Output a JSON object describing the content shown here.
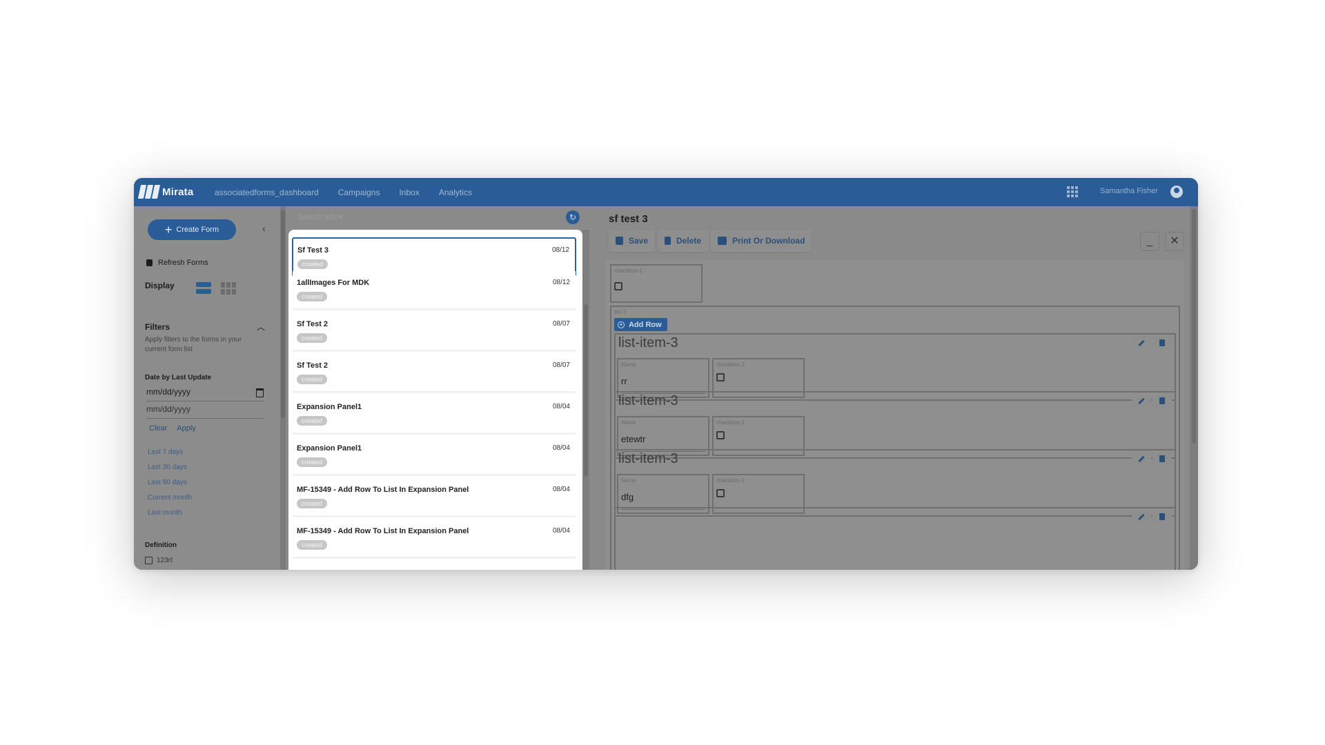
{
  "header": {
    "brand": "Mirata",
    "nav": [
      "associatedforms_dashboard",
      "Campaigns",
      "Inbox",
      "Analytics"
    ],
    "user_name": "Samantha Fisher"
  },
  "sidebar": {
    "create_label": "Create Form",
    "refresh_label": "Refresh Forms",
    "display_label": "Display",
    "filters_title": "Filters",
    "filters_desc": "Apply filters to the forms in your current form list",
    "date_label": "Date by Last Update",
    "date_from": "mm/dd/yyyy",
    "date_to": "mm/dd/yyyy",
    "clear_label": "Clear",
    "apply_label": "Apply",
    "quick_filters": [
      "Last 7 days",
      "Last 30 days",
      "Last 90 days",
      "Current month",
      "Last month"
    ],
    "definition_label": "Definition",
    "definition_items": [
      "123rt"
    ]
  },
  "inbox": {
    "search_placeholder": "Search Inbox",
    "items": [
      {
        "title": "Sf Test 3",
        "date": "08/12",
        "status": "created"
      },
      {
        "title": "1allImages For MDK",
        "date": "08/12",
        "status": "created"
      },
      {
        "title": "Sf Test 2",
        "date": "08/07",
        "status": "created"
      },
      {
        "title": "Sf Test 2",
        "date": "08/07",
        "status": "created"
      },
      {
        "title": "Expansion Panel1",
        "date": "08/04",
        "status": "created"
      },
      {
        "title": "Expansion Panel1",
        "date": "08/04",
        "status": "created"
      },
      {
        "title": "MF-15349 - Add Row To List In Expansion Panel",
        "date": "08/04",
        "status": "created"
      },
      {
        "title": "MF-15349 - Add Row To List In Expansion Panel",
        "date": "08/04",
        "status": "created"
      }
    ]
  },
  "detail": {
    "title": "sf test 3",
    "save_label": "Save",
    "delete_label": "Delete",
    "print_label": "Print Or Download",
    "min_symbol": "_",
    "close_symbol": "✕",
    "checkbox1_label": "checkbox-1",
    "list_label": "list-3",
    "add_row_label": "Add Row",
    "items": [
      {
        "title": "list-item-3",
        "name_label": "Name",
        "name_value": "rr",
        "checkbox_label": "checkbox-2"
      },
      {
        "title": "list-item-3",
        "name_label": "Name",
        "name_value": "etewtr",
        "checkbox_label": "checkbox-2"
      },
      {
        "title": "list-item-3",
        "name_label": "Name",
        "name_value": "dfg",
        "checkbox_label": "checkbox-2"
      }
    ]
  }
}
